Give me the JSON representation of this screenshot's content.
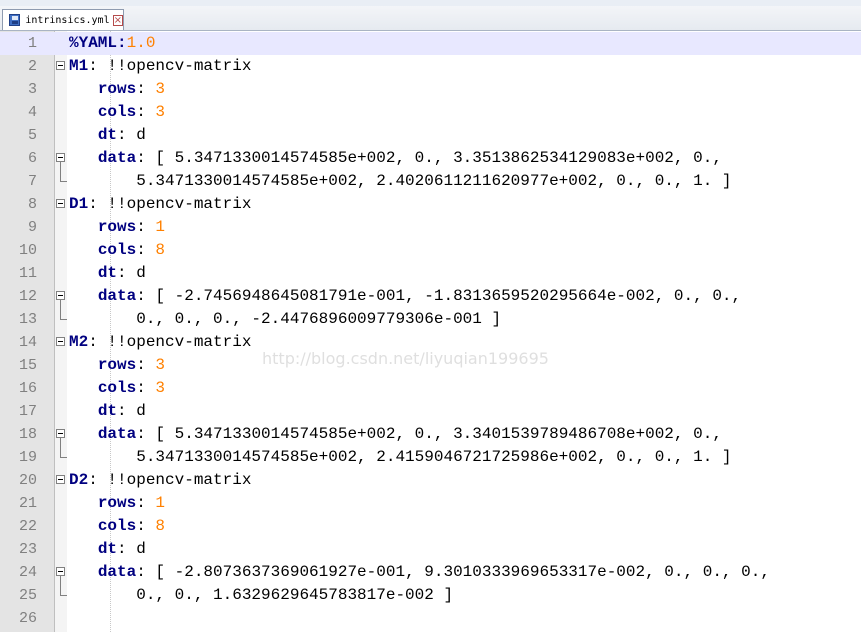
{
  "tab": {
    "filename": "intrinsics.yml",
    "close_glyph": "×"
  },
  "watermark": "http://blog.csdn.net/liyuqian199695",
  "lines": [
    {
      "num": "1",
      "parts": [
        [
          "dir",
          "%YAML:"
        ],
        [
          "num",
          "1.0"
        ]
      ]
    },
    {
      "num": "2",
      "parts": [
        [
          "key",
          "M1"
        ],
        [
          "plain",
          ": !!opencv-matrix"
        ]
      ]
    },
    {
      "num": "3",
      "parts": [
        [
          "plain",
          "   "
        ],
        [
          "key",
          "rows"
        ],
        [
          "plain",
          ": "
        ],
        [
          "num",
          "3"
        ]
      ]
    },
    {
      "num": "4",
      "parts": [
        [
          "plain",
          "   "
        ],
        [
          "key",
          "cols"
        ],
        [
          "plain",
          ": "
        ],
        [
          "num",
          "3"
        ]
      ]
    },
    {
      "num": "5",
      "parts": [
        [
          "plain",
          "   "
        ],
        [
          "key",
          "dt"
        ],
        [
          "plain",
          ": d"
        ]
      ]
    },
    {
      "num": "6",
      "parts": [
        [
          "plain",
          "   "
        ],
        [
          "key",
          "data"
        ],
        [
          "plain",
          ": [ 5.3471330014574585e+002, 0., 3.3513862534129083e+002, 0.,"
        ]
      ]
    },
    {
      "num": "7",
      "parts": [
        [
          "plain",
          "       5.3471330014574585e+002, 2.4020611211620977e+002, 0., 0., 1. ]"
        ]
      ]
    },
    {
      "num": "8",
      "parts": [
        [
          "key",
          "D1"
        ],
        [
          "plain",
          ": !!opencv-matrix"
        ]
      ]
    },
    {
      "num": "9",
      "parts": [
        [
          "plain",
          "   "
        ],
        [
          "key",
          "rows"
        ],
        [
          "plain",
          ": "
        ],
        [
          "num",
          "1"
        ]
      ]
    },
    {
      "num": "10",
      "parts": [
        [
          "plain",
          "   "
        ],
        [
          "key",
          "cols"
        ],
        [
          "plain",
          ": "
        ],
        [
          "num",
          "8"
        ]
      ]
    },
    {
      "num": "11",
      "parts": [
        [
          "plain",
          "   "
        ],
        [
          "key",
          "dt"
        ],
        [
          "plain",
          ": d"
        ]
      ]
    },
    {
      "num": "12",
      "parts": [
        [
          "plain",
          "   "
        ],
        [
          "key",
          "data"
        ],
        [
          "plain",
          ": [ -2.7456948645081791e-001, -1.8313659520295664e-002, 0., 0.,"
        ]
      ]
    },
    {
      "num": "13",
      "parts": [
        [
          "plain",
          "       0., 0., 0., -2.4476896009779306e-001 ]"
        ]
      ]
    },
    {
      "num": "14",
      "parts": [
        [
          "key",
          "M2"
        ],
        [
          "plain",
          ": !!opencv-matrix"
        ]
      ]
    },
    {
      "num": "15",
      "parts": [
        [
          "plain",
          "   "
        ],
        [
          "key",
          "rows"
        ],
        [
          "plain",
          ": "
        ],
        [
          "num",
          "3"
        ]
      ]
    },
    {
      "num": "16",
      "parts": [
        [
          "plain",
          "   "
        ],
        [
          "key",
          "cols"
        ],
        [
          "plain",
          ": "
        ],
        [
          "num",
          "3"
        ]
      ]
    },
    {
      "num": "17",
      "parts": [
        [
          "plain",
          "   "
        ],
        [
          "key",
          "dt"
        ],
        [
          "plain",
          ": d"
        ]
      ]
    },
    {
      "num": "18",
      "parts": [
        [
          "plain",
          "   "
        ],
        [
          "key",
          "data"
        ],
        [
          "plain",
          ": [ 5.3471330014574585e+002, 0., 3.3401539789486708e+002, 0.,"
        ]
      ]
    },
    {
      "num": "19",
      "parts": [
        [
          "plain",
          "       5.3471330014574585e+002, 2.4159046721725986e+002, 0., 0., 1. ]"
        ]
      ]
    },
    {
      "num": "20",
      "parts": [
        [
          "key",
          "D2"
        ],
        [
          "plain",
          ": !!opencv-matrix"
        ]
      ]
    },
    {
      "num": "21",
      "parts": [
        [
          "plain",
          "   "
        ],
        [
          "key",
          "rows"
        ],
        [
          "plain",
          ": "
        ],
        [
          "num",
          "1"
        ]
      ]
    },
    {
      "num": "22",
      "parts": [
        [
          "plain",
          "   "
        ],
        [
          "key",
          "cols"
        ],
        [
          "plain",
          ": "
        ],
        [
          "num",
          "8"
        ]
      ]
    },
    {
      "num": "23",
      "parts": [
        [
          "plain",
          "   "
        ],
        [
          "key",
          "dt"
        ],
        [
          "plain",
          ": d"
        ]
      ]
    },
    {
      "num": "24",
      "parts": [
        [
          "plain",
          "   "
        ],
        [
          "key",
          "data"
        ],
        [
          "plain",
          ": [ -2.8073637369061927e-001, 9.3010333969653317e-002, 0., 0., 0.,"
        ]
      ]
    },
    {
      "num": "25",
      "parts": [
        [
          "plain",
          "       0., 0., 1.6329629645783817e-002 ]"
        ]
      ]
    },
    {
      "num": "26",
      "parts": []
    }
  ]
}
